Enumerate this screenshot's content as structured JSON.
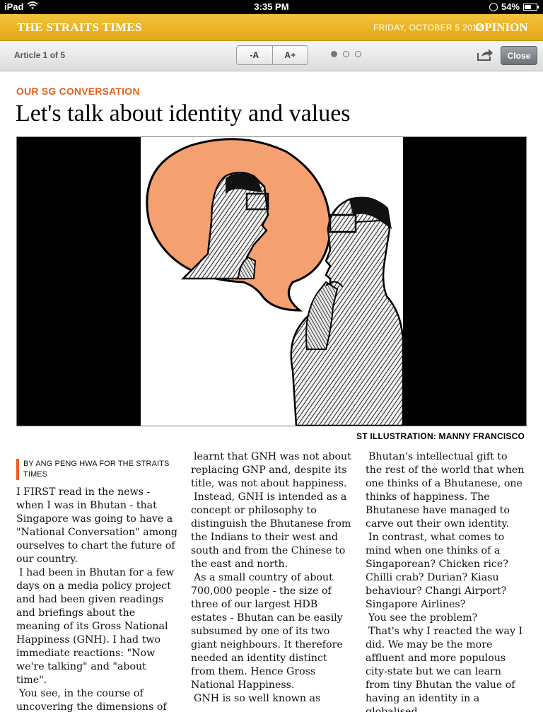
{
  "status_bar": {
    "device": "iPad",
    "time": "3:35 PM",
    "battery": "54%",
    "battery_level": 0.54
  },
  "masthead": {
    "brand": "THE STRAITS TIMES",
    "date": "FRIDAY, OCTOBER 5 2012",
    "section": "OPINION"
  },
  "toolbar": {
    "article_count": "Article 1 of 5",
    "font_smaller": "-A",
    "font_larger": "A+",
    "close": "Close",
    "pages": 3,
    "active_page": 1
  },
  "article": {
    "kicker": "OUR SG CONVERSATION",
    "headline": "Let's talk about identity and values",
    "image_credit": "ST ILLUSTRATION: MANNY FRANCISCO",
    "byline": "BY ANG PENG HWA FOR THE STRAITS TIMES",
    "columns": [
      [
        "I FIRST read in the news - when I was in Bhutan - that Singapore was going to have a \"National Conversation\" among ourselves to chart the future of our country.",
        "I had been in Bhutan for a few days on a media policy project and had been given readings and briefings about the meaning of its Gross National Happiness (GNH). I had two immediate reactions: \"Now we're talking\" and \"about time\".",
        "You see, in the course of uncovering the dimensions of Gross National Happiness, I"
      ],
      [
        "learnt that GNH was not about replacing GNP and, despite its title, was not about happiness.",
        "Instead, GNH is intended as a concept or philosophy to distinguish the Bhutanese from the Indians to their west and south and from the Chinese to the east and north.",
        "As a small country of about 700,000 people - the size of three of our largest HDB estates - Bhutan can be easily subsumed by one of its two giant neighbours. It therefore needed an identity distinct from them. Hence Gross National Happiness.",
        "GNH is so well known as"
      ],
      [
        "Bhutan's intellectual gift to the rest of the world that when one thinks of a Bhutanese, one thinks of happiness. The Bhutanese have managed to carve out their own identity.",
        "In contrast, what comes to mind when one thinks of a Singaporean? Chicken rice? Chilli crab? Durian? Kiasu behaviour? Changi Airport? Singapore Airlines?",
        "You see the problem?",
        "That's why I reacted the way I did. We may be the more affluent and more populous city-state but we can learn from tiny Bhutan the value of having an identity in a globalised"
      ]
    ]
  },
  "colors": {
    "masthead": "#e8b127",
    "accent": "#e8601c",
    "bubble": "#f4a070"
  }
}
